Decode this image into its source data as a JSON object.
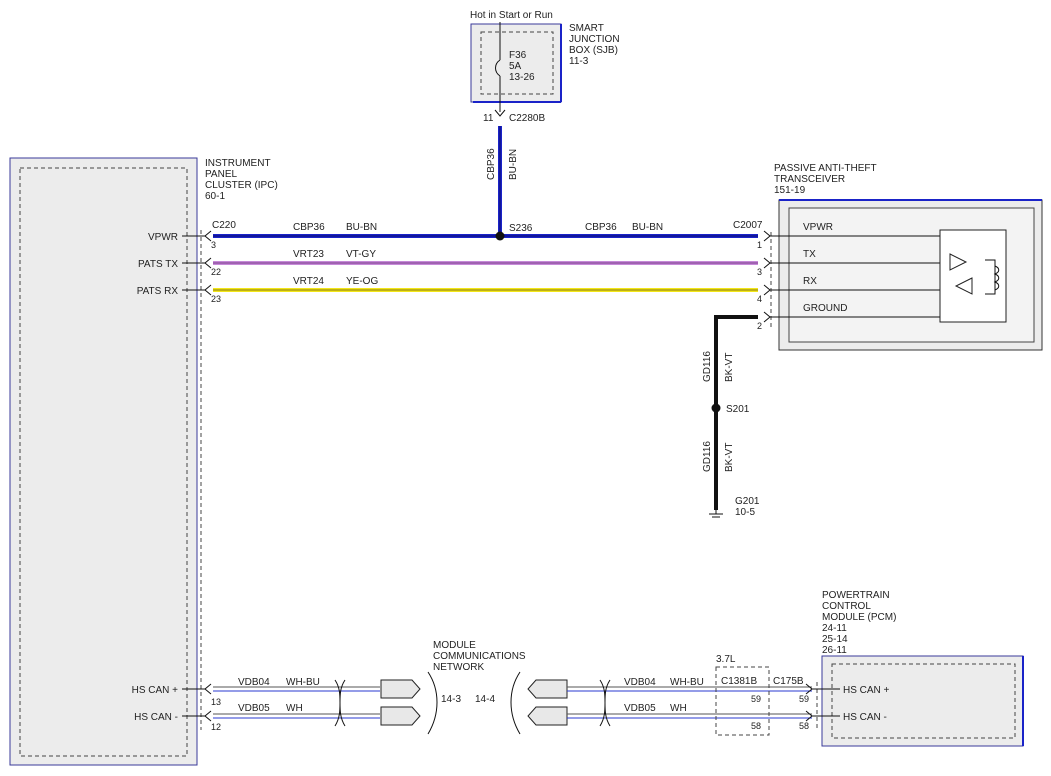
{
  "sjb": {
    "supply": "Hot in Start or Run",
    "title_l1": "SMART",
    "title_l2": "JUNCTION",
    "title_l3": "BOX (SJB)",
    "ref": "11-3",
    "fuse_name": "F36",
    "fuse_rating": "5A",
    "fuse_ref": "13-26",
    "pin": "11",
    "connector": "C2280B"
  },
  "ipc": {
    "title_l1": "INSTRUMENT",
    "title_l2": "PANEL",
    "title_l3": "CLUSTER (IPC)",
    "ref": "60-1",
    "connector": "C220",
    "pins": [
      {
        "label": "VPWR",
        "pin": "3"
      },
      {
        "label": "PATS TX",
        "pin": "22"
      },
      {
        "label": "PATS RX",
        "pin": "23"
      },
      {
        "label": "HS CAN +",
        "pin": "13"
      },
      {
        "label": "HS CAN -",
        "pin": "12"
      }
    ]
  },
  "wires": {
    "vpwr_circuit": "CBP36",
    "vpwr_color": "BU-BN",
    "tx_circuit": "VRT23",
    "tx_color": "VT-GY",
    "rx_circuit": "VRT24",
    "rx_color": "YE-OG",
    "drop_circuit": "CBP36",
    "drop_color": "BU-BN",
    "gnd_circuit": "GD116",
    "gnd_color": "BK-VT",
    "can_plus_circuit": "VDB04",
    "can_plus_color": "WH-BU",
    "can_minus_circuit": "VDB05",
    "can_minus_color": "WH"
  },
  "splices": {
    "s236": "S236",
    "s201": "S201"
  },
  "pats": {
    "title_l1": "PASSIVE ANTI-THEFT",
    "title_l2": "TRANSCEIVER",
    "ref": "151-19",
    "connector": "C2007",
    "pins": [
      {
        "label": "VPWR",
        "pin": "1"
      },
      {
        "label": "TX",
        "pin": "3"
      },
      {
        "label": "RX",
        "pin": "4"
      },
      {
        "label": "GROUND",
        "pin": "2"
      }
    ]
  },
  "ground": {
    "name": "G201",
    "ref": "10-5"
  },
  "network": {
    "title_l1": "MODULE",
    "title_l2": "COMMUNICATIONS",
    "title_l3": "NETWORK",
    "ref_left": "14-3",
    "ref_right": "14-4"
  },
  "pcm": {
    "title_l1": "POWERTRAIN",
    "title_l2": "CONTROL",
    "title_l3": "MODULE (PCM)",
    "ref1": "24-11",
    "ref2": "25-14",
    "ref3": "26-11",
    "engine": "3.7L",
    "inline_connector": "C1381B",
    "connector": "C175B",
    "inline_pin_plus": "59",
    "inline_pin_minus": "58",
    "pin_plus": "59",
    "pin_minus": "58",
    "label_plus": "HS CAN +",
    "label_minus": "HS CAN -"
  }
}
